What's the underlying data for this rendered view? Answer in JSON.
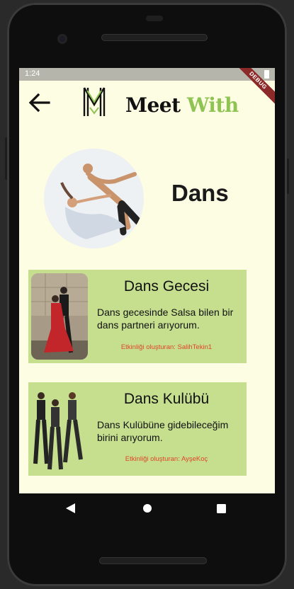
{
  "status_bar": {
    "time": "1:24",
    "debug_label": "DEBUG"
  },
  "header": {
    "back_icon": "arrow-left-icon",
    "logo_letter": "M",
    "logo_word1": "Meet",
    "logo_word2": "With"
  },
  "category": {
    "title": "Dans",
    "image": "dancing-couple-photo"
  },
  "events": [
    {
      "title": "Dans Gecesi",
      "description": "Dans gecesinde Salsa bilen bir dans partneri arıyorum.",
      "owner": "Etkinliği oluşturan: SalihTekin1",
      "image": "tango-couple-photo"
    },
    {
      "title": "Dans Kulübü",
      "description": "Dans Kulübüne gidebileceğim birini arıyorum.",
      "owner": "Etkinliği oluşturan: AyşeKoç",
      "image": "hiphop-dancers-photo"
    }
  ],
  "colors": {
    "background": "#fdfde4",
    "card": "#c5df8f",
    "accent": "#8fc454",
    "owner_text": "#e0452a"
  },
  "nav": {
    "back": "nav-back-icon",
    "home": "nav-home-icon",
    "recent": "nav-recent-icon"
  }
}
